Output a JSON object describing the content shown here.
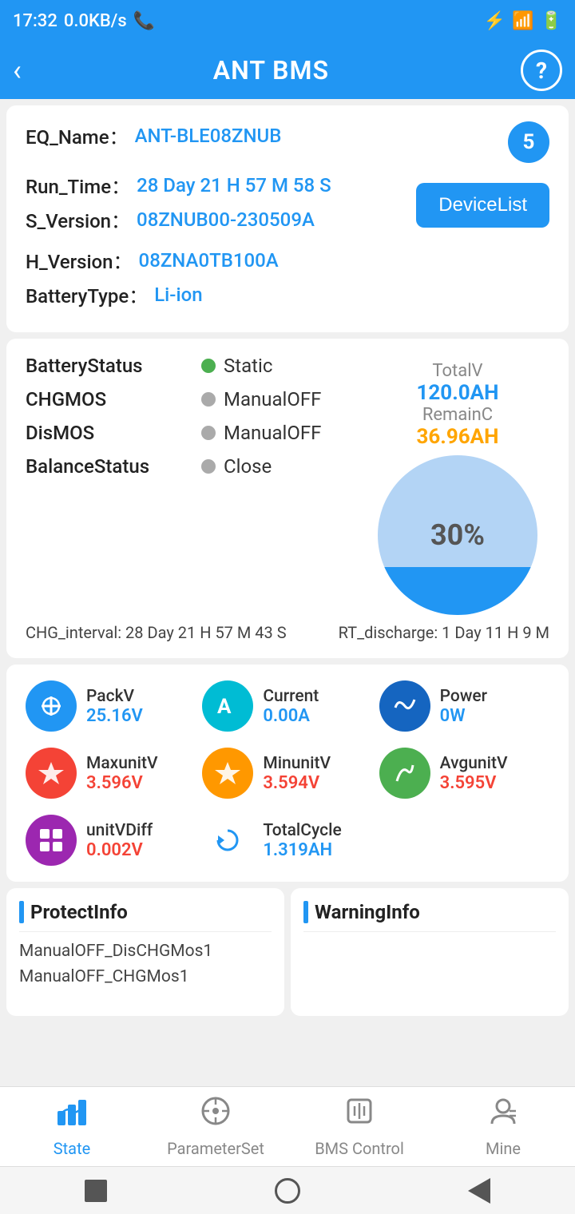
{
  "statusBar": {
    "time": "17:32",
    "network": "0.0KB/s",
    "battery": "70"
  },
  "appBar": {
    "title": "ANT BMS",
    "backLabel": "‹",
    "helpLabel": "?"
  },
  "deviceInfo": {
    "eqNameLabel": "EQ_Name：",
    "eqNameValue": "ANT-BLE08ZNUB",
    "badgeCount": "5",
    "runTimeLabel": "Run_Time：",
    "runTimeValue": "28 Day 21 H 57 M 58 S",
    "sVersionLabel": "S_Version：",
    "sVersionValue": "08ZNUB00-230509A",
    "deviceListLabel": "DeviceList",
    "hVersionLabel": "H_Version：",
    "hVersionValue": "08ZNA0TB100A",
    "batteryTypeLabel": "BatteryType：",
    "batteryTypeValue": "Li-ion"
  },
  "batteryStatus": {
    "statusLabel": "BatteryStatus",
    "statusValue": "Static",
    "statusDot": "green",
    "chgMosLabel": "CHGMOS",
    "chgMosValue": "ManualOFF",
    "chgMosDot": "gray",
    "disMosLabel": "DisMOS",
    "disMosValue": "ManualOFF",
    "disMosDot": "gray",
    "balanceLabel": "BalanceStatus",
    "balanceDot": "gray",
    "balanceValue": "Close",
    "totalVLabel": "TotalV",
    "totalVValue": "120.0AH",
    "remainCLabel": "RemainC",
    "remainCValue": "36.96AH",
    "gaugePercent": "30%",
    "chgIntervalLabel": "CHG_interval:",
    "chgIntervalValue": "28 Day 21 H 57 M 43 S",
    "rtDischargeLabel": "RT_discharge:",
    "rtDischargeValue": "1 Day 11 H 9 M"
  },
  "metrics": [
    {
      "name": "PackV",
      "value": "25.16V",
      "color": "blue",
      "icon": "⌁",
      "iconBg": "metric-icon-blue"
    },
    {
      "name": "Current",
      "value": "0.00A",
      "color": "blue",
      "icon": "Ⓐ",
      "iconBg": "metric-icon-teal"
    },
    {
      "name": "Power",
      "value": "0W",
      "color": "blue",
      "icon": "〜",
      "iconBg": "metric-icon-dark-blue"
    },
    {
      "name": "MaxunitV",
      "value": "3.596V",
      "color": "red",
      "icon": "⚡",
      "iconBg": "metric-icon-red"
    },
    {
      "name": "MinunitV",
      "value": "3.594V",
      "color": "red",
      "icon": "⚡",
      "iconBg": "metric-icon-orange"
    },
    {
      "name": "AvgunitV",
      "value": "3.595V",
      "color": "red",
      "icon": "≋",
      "iconBg": "metric-icon-green"
    },
    {
      "name": "unitVDiff",
      "value": "0.002V",
      "color": "red",
      "icon": "▦",
      "iconBg": "metric-icon-purple"
    },
    {
      "name": "TotalCycle",
      "value": "1.319AH",
      "color": "blue",
      "icon": "↻",
      "iconBg": "metric-icon-cycle"
    }
  ],
  "protectInfo": {
    "title": "ProtectInfo",
    "items": [
      "ManualOFF_DisCHGMos1",
      "ManualOFF_CHGMos1"
    ]
  },
  "warningInfo": {
    "title": "WarningInfo",
    "items": []
  },
  "bottomNav": [
    {
      "id": "state",
      "label": "State",
      "icon": "📊",
      "active": true
    },
    {
      "id": "parameterset",
      "label": "ParameterSet",
      "icon": "⚙",
      "active": false
    },
    {
      "id": "bmscontrol",
      "label": "BMS Control",
      "icon": "🎛",
      "active": false
    },
    {
      "id": "mine",
      "label": "Mine",
      "icon": "👤",
      "active": false
    }
  ]
}
